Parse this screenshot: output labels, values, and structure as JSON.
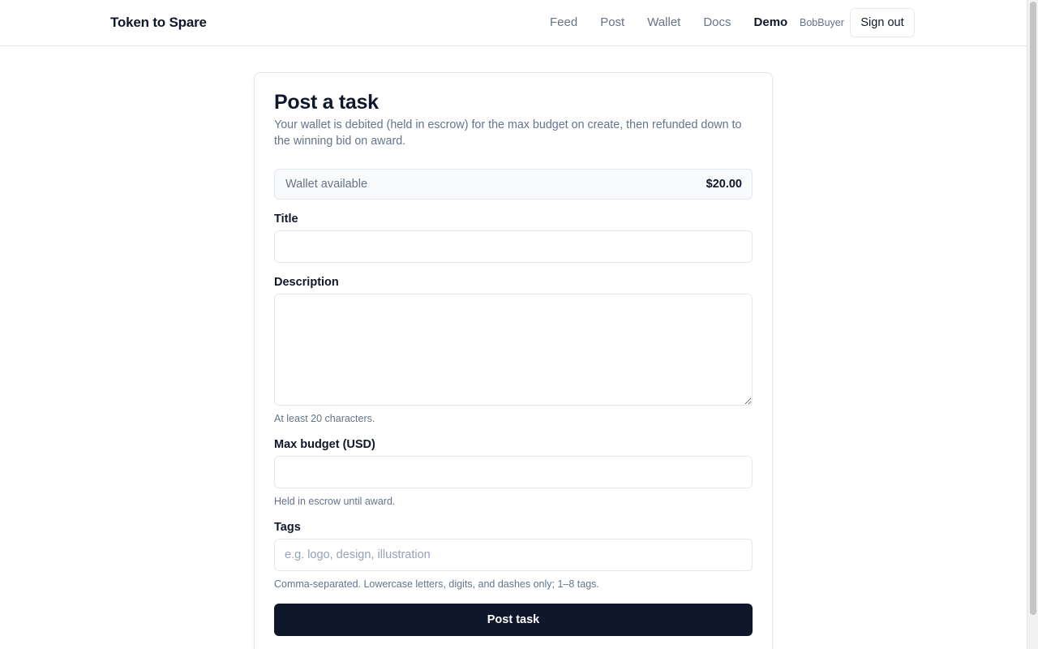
{
  "header": {
    "brand": "Token to Spare",
    "nav": [
      "Feed",
      "Post",
      "Wallet",
      "Docs",
      "Demo"
    ],
    "active_nav": "Demo",
    "username": "BobBuyer",
    "signout_label": "Sign out"
  },
  "form": {
    "title": "Post a task",
    "subtitle": "Your wallet is debited (held in escrow) for the max budget on create, then refunded down to the winning bid on award.",
    "wallet": {
      "label": "Wallet available",
      "value": "$20.00"
    },
    "fields": {
      "title": {
        "label": "Title",
        "value": "",
        "placeholder": ""
      },
      "description": {
        "label": "Description",
        "value": "",
        "placeholder": "",
        "hint": "At least 20 characters."
      },
      "budget": {
        "label": "Max budget (USD)",
        "value": "",
        "placeholder": "",
        "hint": "Held in escrow until award."
      },
      "tags": {
        "label": "Tags",
        "value": "",
        "placeholder": "e.g. logo, design, illustration",
        "hint": "Comma-separated. Lowercase letters, digits, and dashes only; 1–8 tags."
      }
    },
    "submit_label": "Post task"
  },
  "colors": {
    "primary_button": "#0f172a",
    "muted_text": "#64748b",
    "border": "#e5e7eb"
  }
}
